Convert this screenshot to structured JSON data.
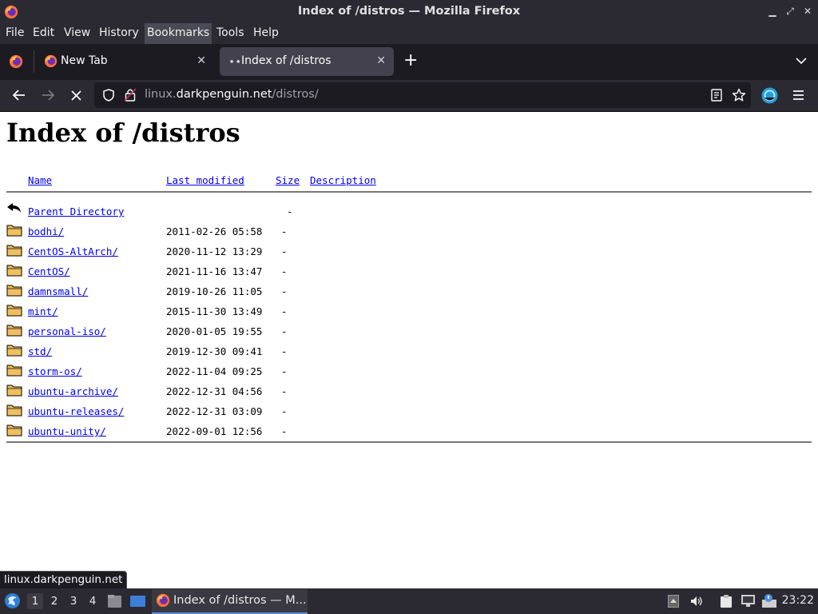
{
  "window": {
    "title": "Index of /distros — Mozilla Firefox"
  },
  "menu": [
    "File",
    "Edit",
    "View",
    "History",
    "Bookmarks",
    "Tools",
    "Help"
  ],
  "tabs": [
    {
      "label": "New Tab",
      "active": false
    },
    {
      "label": "Index of /distros",
      "active": true
    }
  ],
  "toolbar": {
    "url_prefix": "linux.",
    "url_domain": "darkpenguin.net",
    "url_path": "/distros/"
  },
  "page": {
    "heading": "Index of /distros",
    "columns": {
      "name": "Name",
      "modified": "Last modified",
      "size": "Size",
      "description": "Description"
    },
    "parent": {
      "name": "Parent Directory",
      "size": "-"
    },
    "entries": [
      {
        "name": "bodhi/",
        "date": "2011-02-26 05:58",
        "size": "-"
      },
      {
        "name": "CentOS-AltArch/",
        "date": "2020-11-12 13:29",
        "size": "-"
      },
      {
        "name": "CentOS/",
        "date": "2021-11-16 13:47",
        "size": "-"
      },
      {
        "name": "damnsmall/",
        "date": "2019-10-26 11:05",
        "size": "-"
      },
      {
        "name": "mint/",
        "date": "2015-11-30 13:49",
        "size": "-"
      },
      {
        "name": "personal-iso/",
        "date": "2020-01-05 19:55",
        "size": "-"
      },
      {
        "name": "std/",
        "date": "2019-12-30 09:41",
        "size": "-"
      },
      {
        "name": "storm-os/",
        "date": "2022-11-04 09:25",
        "size": "-"
      },
      {
        "name": "ubuntu-archive/",
        "date": "2022-12-31 04:56",
        "size": "-"
      },
      {
        "name": "ubuntu-releases/",
        "date": "2022-12-31 03:09",
        "size": "-"
      },
      {
        "name": "ubuntu-unity/",
        "date": "2022-09-01 12:56",
        "size": "-"
      }
    ]
  },
  "status": {
    "text": "linux.darkpenguin.net"
  },
  "taskbar": {
    "workspaces": [
      "1",
      "2",
      "3",
      "4"
    ],
    "task_label": "Index of /distros — M...",
    "clock": "23:22"
  }
}
